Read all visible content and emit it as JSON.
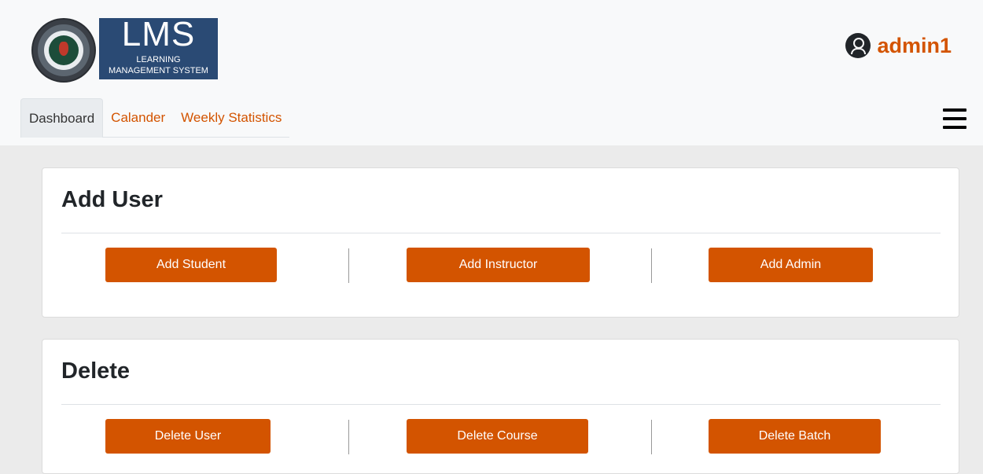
{
  "logo": {
    "title": "LMS",
    "subtitle_line1": "LEARNING",
    "subtitle_line2": "MANAGEMENT SYSTEM"
  },
  "user": {
    "name": "admin1",
    "icon": "user-circle-icon"
  },
  "tabs": [
    {
      "label": "Dashboard",
      "active": true
    },
    {
      "label": "Calander",
      "active": false
    },
    {
      "label": "Weekly Statistics",
      "active": false
    }
  ],
  "menu_icon": "hamburger-icon",
  "cards": {
    "add_user": {
      "title": "Add User",
      "buttons": [
        "Add Student",
        "Add Instructor",
        "Add Admin"
      ]
    },
    "delete": {
      "title": "Delete",
      "buttons": [
        "Delete User",
        "Delete Course",
        "Delete Batch"
      ]
    }
  },
  "colors": {
    "accent": "#d35400",
    "header_bg": "#f8f9fa",
    "page_bg": "#ebebeb",
    "logo_bg": "#2a4a74"
  }
}
